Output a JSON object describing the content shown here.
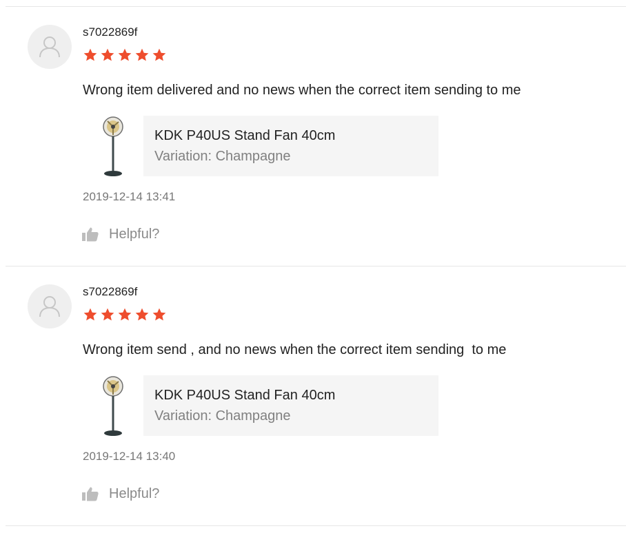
{
  "colors": {
    "star": "#ee4d2d",
    "divider": "#e6e6e6",
    "card_bg": "#f5f5f5",
    "muted_text": "#808080"
  },
  "reviews": [
    {
      "username": "s7022869f",
      "rating": 5,
      "comment": "Wrong item delivered and no news when the correct item sending to me",
      "product": {
        "name": "KDK P40US Stand Fan 40cm",
        "variation": "Variation: Champagne"
      },
      "timestamp": "2019-12-14 13:41",
      "helpful_label": "Helpful?"
    },
    {
      "username": "s7022869f",
      "rating": 5,
      "comment": "Wrong item send , and no news when the correct item sending  to me",
      "product": {
        "name": "KDK P40US Stand Fan 40cm",
        "variation": "Variation: Champagne"
      },
      "timestamp": "2019-12-14 13:40",
      "helpful_label": "Helpful?"
    }
  ]
}
